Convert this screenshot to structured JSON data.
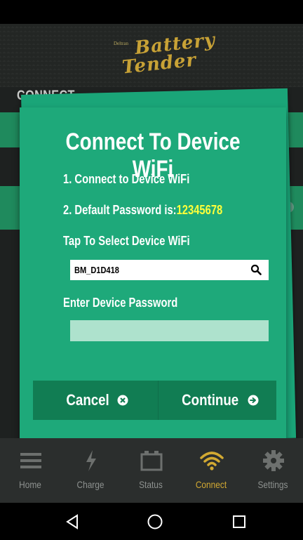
{
  "header": {
    "brand_small": "Deltran",
    "logo_line1": "Battery",
    "logo_line2": "Tender"
  },
  "page_title": "CONNECT",
  "modal": {
    "title": "Connect To Device WiFi",
    "step1": "1. Connect to Device WiFi",
    "step2_prefix": "2. Default Password is:",
    "step2_password": "12345678",
    "select_label": "Tap To Select Device WiFi",
    "selected_wifi": "BM_D1D418",
    "password_label": "Enter Device Password",
    "password_value": "",
    "cancel_label": "Cancel",
    "continue_label": "Continue"
  },
  "tabs": [
    {
      "label": "Home",
      "icon": "menu-icon"
    },
    {
      "label": "Charge",
      "icon": "bolt-icon"
    },
    {
      "label": "Status",
      "icon": "battery-icon"
    },
    {
      "label": "Connect",
      "icon": "wifi-icon",
      "active": true
    },
    {
      "label": "Settings",
      "icon": "gear-icon"
    }
  ],
  "colors": {
    "modal_green": "#1ea97a",
    "button_bar": "#117d53",
    "password_highlight": "#ffff3a",
    "active_tab": "#d2a932"
  }
}
